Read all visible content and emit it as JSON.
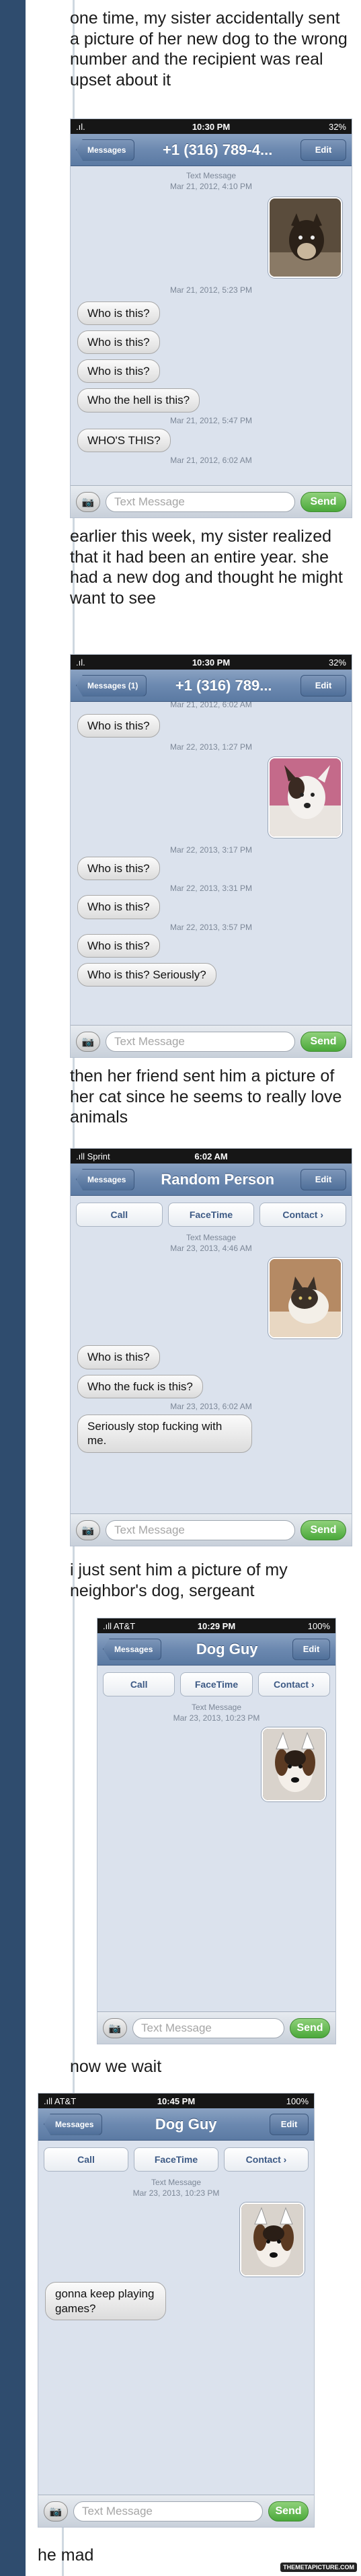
{
  "captions": {
    "c1": "one time, my sister accidentally sent a picture of her new dog to the wrong number and the recipient was real upset about it",
    "c2": "earlier this week, my sister realized that it had been an entire year. she had a new dog and thought he might want to see",
    "c3": "then her friend sent him a picture of her cat since he seems to really love animals",
    "c4": "i just sent him a picture of my neighbor's dog, sergeant",
    "c5": "now we wait",
    "c6": "he mad"
  },
  "phone1": {
    "status": {
      "carrier": ".ıl.",
      "time": "10:30 PM",
      "battery": "32%"
    },
    "back": "Messages",
    "title": "+1 (316) 789-4...",
    "edit": "Edit",
    "ts_top": "Text Message\nMar 21, 2012, 4:10 PM",
    "ts_2": "Mar 21, 2012, 5:23 PM",
    "m1": "Who is this?",
    "m2": "Who is this?",
    "m3": "Who is this?",
    "m4": "Who the hell is this?",
    "ts_3": "Mar 21, 2012, 5:47 PM",
    "m5": "WHO'S THIS?",
    "ts_4": "Mar 21, 2012, 6:02 AM",
    "placeholder": "Text Message",
    "send": "Send"
  },
  "phone2": {
    "status": {
      "carrier": ".ıl.",
      "time": "10:30 PM",
      "battery": "32%"
    },
    "back": "Messages (1)",
    "title": "+1 (316) 789...",
    "edit": "Edit",
    "ts_top": "Mar 21, 2012, 6:02 AM",
    "m1": "Who is this?",
    "ts_2": "Mar 22, 2013, 1:27 PM",
    "ts_3": "Mar 22, 2013, 3:17 PM",
    "m2": "Who is this?",
    "ts_4": "Mar 22, 2013, 3:31 PM",
    "m3": "Who is this?",
    "ts_5": "Mar 22, 2013, 3:57 PM",
    "m4": "Who is this?",
    "m5": "Who is this? Seriously?",
    "placeholder": "Text Message",
    "send": "Send"
  },
  "phone3": {
    "status": {
      "carrier": ".ıll Sprint",
      "time": "6:02 AM",
      "battery": ""
    },
    "back": "Messages",
    "title": "Random Person",
    "edit": "Edit",
    "call": "Call",
    "facetime": "FaceTime",
    "contact": "Contact",
    "ts_top": "Text Message\nMar 23, 2013, 4:46 AM",
    "m1": "Who is this?",
    "m2": "Who the fuck is this?",
    "ts_2": "Mar 23, 2013, 6:02 AM",
    "m3": "Seriously stop fucking with me.",
    "placeholder": "Text Message",
    "send": "Send"
  },
  "phone4": {
    "status": {
      "carrier": ".ıll AT&T",
      "time": "10:29 PM",
      "battery": "100%"
    },
    "back": "Messages",
    "title": "Dog Guy",
    "edit": "Edit",
    "call": "Call",
    "facetime": "FaceTime",
    "contact": "Contact",
    "ts_top": "Text Message\nMar 23, 2013, 10:23 PM",
    "placeholder": "Text Message",
    "send": "Send"
  },
  "phone5": {
    "status": {
      "carrier": ".ıll AT&T",
      "time": "10:45 PM",
      "battery": "100%"
    },
    "back": "Messages",
    "title": "Dog Guy",
    "edit": "Edit",
    "call": "Call",
    "facetime": "FaceTime",
    "contact": "Contact",
    "ts_top": "Text Message\nMar 23, 2013, 10:23 PM",
    "m1": "gonna keep playing games?",
    "placeholder": "Text Message",
    "send": "Send"
  },
  "watermark": "THEMETAPICTURE.COM"
}
